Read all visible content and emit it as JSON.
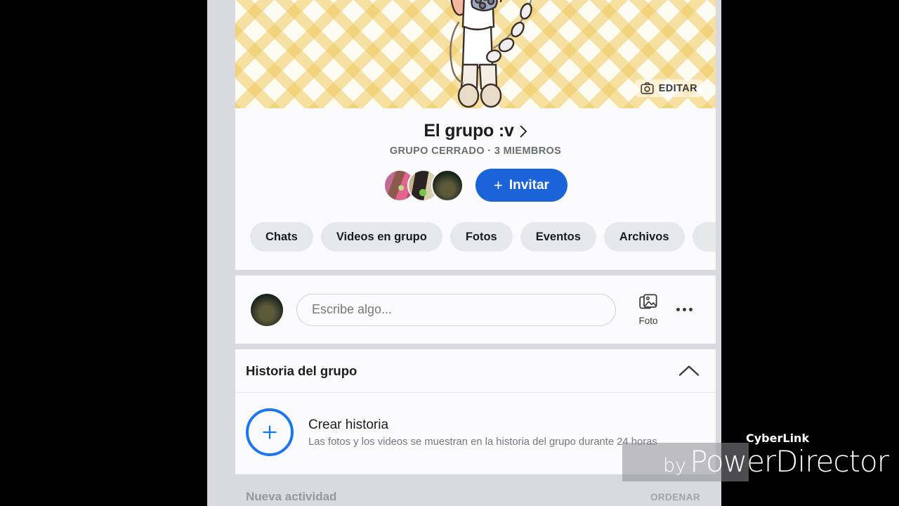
{
  "app": {
    "name": "Facebook Groups (mobile)"
  },
  "colors": {
    "accent_blue": "#1b63d8",
    "story_blue": "#1877f2",
    "page_bg": "#d8dadf",
    "card_bg": "#fbfbfd",
    "pill_bg": "#e7e8ea",
    "text_primary": "#1b1c1e",
    "text_secondary": "#75787d",
    "cover_plaid": "#f0c85f"
  },
  "cover": {
    "edit_label": "EDITAR",
    "edit_icon": "camera-icon"
  },
  "group": {
    "name": "El grupo :v",
    "chevron_icon": "chevron-right-icon",
    "meta": "GRUPO CERRADO · 3 MIEMBROS",
    "privacy": "GRUPO CERRADO",
    "member_count": "3 MIEMBROS",
    "members": [
      {
        "name": "member-avatar-1"
      },
      {
        "name": "member-avatar-2"
      },
      {
        "name": "member-avatar-3"
      }
    ],
    "invite_label": "Invitar",
    "invite_plus": "+"
  },
  "tabs": [
    {
      "label": "Chats"
    },
    {
      "label": "Videos en grupo"
    },
    {
      "label": "Fotos"
    },
    {
      "label": "Eventos"
    },
    {
      "label": "Archivos"
    },
    {
      "label": ""
    }
  ],
  "composer": {
    "placeholder": "Escribe algo...",
    "value": "",
    "photo_label": "Foto",
    "photo_icon": "photos-icon",
    "more_icon": "ellipsis-icon",
    "avatar_icon": "user-avatar"
  },
  "story_section": {
    "title": "Historia del grupo",
    "collapse_icon": "chevron-up-icon",
    "create_title": "Crear historia",
    "create_subtitle": "Las fotos y los videos se muestran en la historia del grupo durante 24 horas",
    "plus_icon": "plus-icon"
  },
  "feed_peek": {
    "label": "Nueva actividad",
    "sort_label": "ORDENAR"
  },
  "watermark": {
    "by": "by",
    "brand": "CyberLink",
    "product": "PowerDirector"
  }
}
